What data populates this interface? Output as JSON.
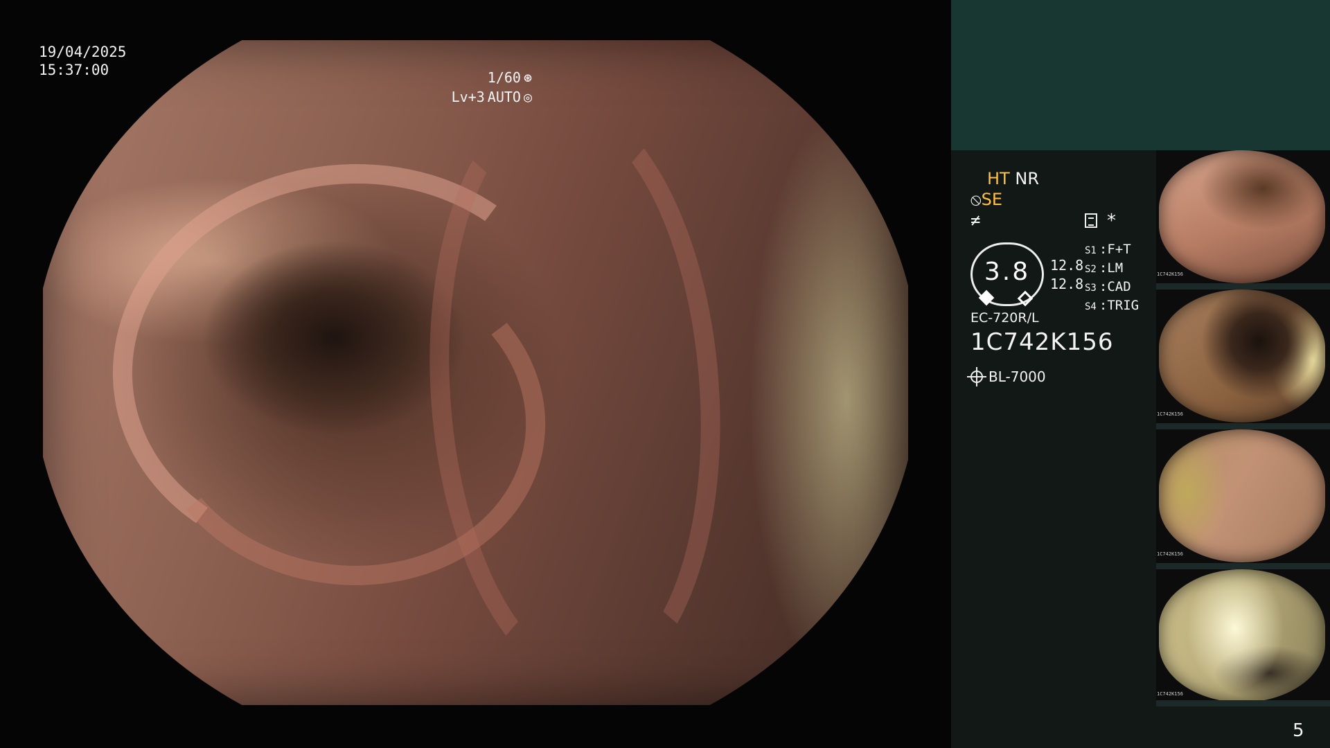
{
  "overlay": {
    "date": "19/04/2025",
    "time": "15:37:00",
    "shutter_ratio": "1/60",
    "shutter_icon": "shutter-icon",
    "light_level": "Lv+3",
    "exposure_mode": "AUTO",
    "exposure_icon": "auto-exposure-icon"
  },
  "panel": {
    "ht_label": "HT",
    "nr_label": "NR",
    "se_label": "SE",
    "se_icon": "structure-enhance-icon",
    "color_enhance_icon": "color-enhance-icon",
    "dial_value": "3.8",
    "values": [
      "12.8",
      "12.8"
    ],
    "settings_icon": "settings-icon",
    "star": "*",
    "slots": [
      {
        "key": "S1",
        "value": "F+T"
      },
      {
        "key": "S2",
        "value": "LM"
      },
      {
        "key": "S3",
        "value": "CAD"
      },
      {
        "key": "S4",
        "value": "TRIG"
      }
    ],
    "scope_model": "EC-720R/L",
    "scope_serial": "1C742K156",
    "light_source_icon": "light-source-icon",
    "light_source": "BL-7000",
    "page_number": "5"
  },
  "thumbnails": [
    {
      "label": "1C742K156",
      "index": "4"
    },
    {
      "label": "1C742K156",
      "index": "3"
    },
    {
      "label": "1C742K156",
      "index": "2"
    },
    {
      "label": "1C742K156",
      "index": "1"
    }
  ],
  "colors": {
    "accent_amber": "#ffc043",
    "panel_bg": "#111815",
    "panel_top_bg": "#183733"
  }
}
